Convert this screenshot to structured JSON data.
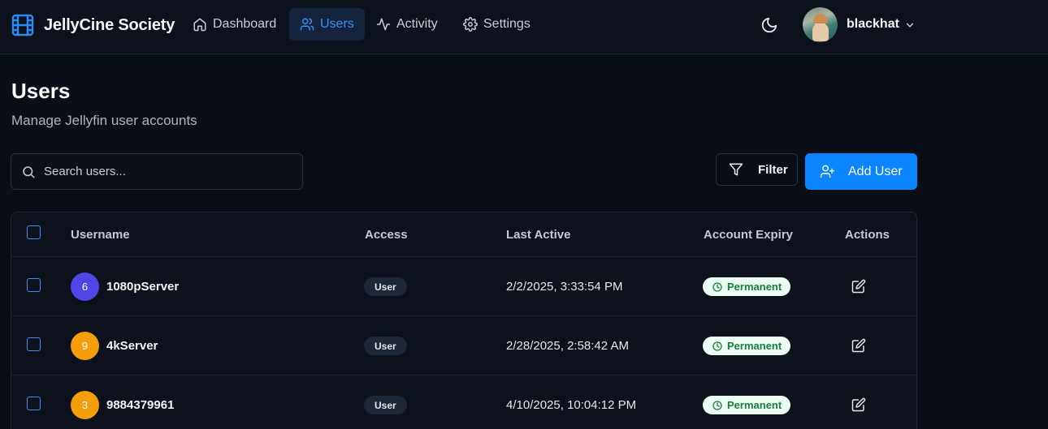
{
  "app": {
    "name": "JellyCine Society"
  },
  "nav": {
    "items": [
      {
        "label": "Dashboard",
        "icon": "home-icon"
      },
      {
        "label": "Users",
        "icon": "users-icon",
        "active": true
      },
      {
        "label": "Activity",
        "icon": "activity-icon"
      },
      {
        "label": "Settings",
        "icon": "gear-icon"
      }
    ]
  },
  "user_menu": {
    "username": "blackhat"
  },
  "page": {
    "title": "Users",
    "subtitle": "Manage Jellyfin user accounts"
  },
  "toolbar": {
    "search_placeholder": "Search users...",
    "filter_label": "Filter",
    "add_user_label": "Add User"
  },
  "table": {
    "headers": {
      "username": "Username",
      "access": "Access",
      "last_active": "Last Active",
      "account_expiry": "Account Expiry",
      "actions": "Actions"
    },
    "rows": [
      {
        "avatar_letter": "6",
        "avatar_color": "#4f46e5",
        "username": "1080pServer",
        "access": "User",
        "last_active": "2/2/2025, 3:33:54 PM",
        "expiry": "Permanent"
      },
      {
        "avatar_letter": "9",
        "avatar_color": "#f59e0b",
        "username": "4kServer",
        "access": "User",
        "last_active": "2/28/2025, 2:58:42 AM",
        "expiry": "Permanent"
      },
      {
        "avatar_letter": "3",
        "avatar_color": "#f59e0b",
        "username": "9884379961",
        "access": "User",
        "last_active": "4/10/2025, 10:04:12 PM",
        "expiry": "Permanent"
      }
    ]
  },
  "colors": {
    "accent": "#0b84ff",
    "active_nav_text": "#3b8ef5",
    "background": "#0a0e17",
    "badge_success_bg": "#ecfdf3",
    "badge_success_text": "#18803c"
  }
}
